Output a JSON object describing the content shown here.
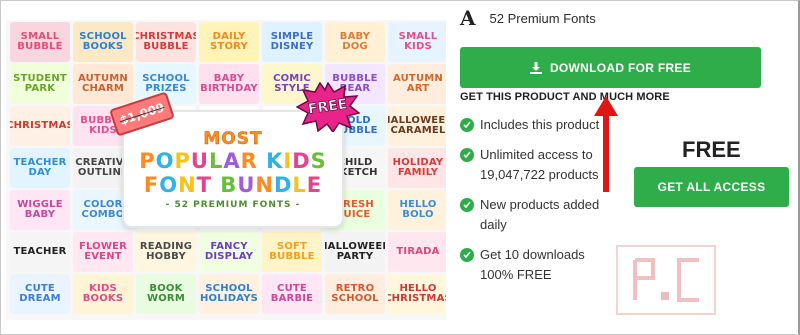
{
  "product": {
    "title_glyph": "A",
    "title": "52 Premium Fonts"
  },
  "collage": {
    "tiles": [
      [
        "SMALL BUBBLE",
        "#f8d6e0",
        "#e64b7a"
      ],
      [
        "SCHOOL BOOKS",
        "#fbe9c6",
        "#2f7fd4"
      ],
      [
        "CHRISTMAS BUBBLE",
        "#fde3e0",
        "#d43a3a"
      ],
      [
        "DAILY STORY",
        "#fff3b8",
        "#f08a1f"
      ],
      [
        "SIMPLE DISNEY",
        "#dff2ff",
        "#3c6ec8"
      ],
      [
        "BABY DOG",
        "#fff0d6",
        "#e07b32"
      ],
      [
        "SMALL KIDS",
        "#e6f4ff",
        "#e84c8b"
      ],
      [
        "STUDENT PARK",
        "#f0ffd9",
        "#6aa52a"
      ],
      [
        "AUTUMN CHARM",
        "#ffe8d6",
        "#c8622e"
      ],
      [
        "SCHOOL PRIZES",
        "#e6f7ff",
        "#3b86d6"
      ],
      [
        "BABY BIRTHDAY",
        "#ffe0ef",
        "#d84b93"
      ],
      [
        "COMIC STYLE",
        "#fff7cc",
        "#7a3fc4"
      ],
      [
        "BUBBLE BEAR",
        "#f3e6ff",
        "#8d4cc8"
      ],
      [
        "AUTUMN ART",
        "#ffeedd",
        "#d4662a"
      ],
      [
        "CHRISTMAS",
        "#fff0e6",
        "#c83a2a"
      ],
      [
        "BUBBLE KIDS",
        "#ffe3f1",
        "#e24d8f"
      ],
      [
        "",
        "#ffffff",
        "#ffffff"
      ],
      [
        "",
        "#ffffff",
        "#ffffff"
      ],
      [
        "",
        "#ffffff",
        "#ffffff"
      ],
      [
        "BOLD BUBBLE",
        "#e8f6ff",
        "#2f6fd0"
      ],
      [
        "HALLOWEEN CARAMEL",
        "#fff1dc",
        "#6b3a1e"
      ],
      [
        "TEACHER DAY",
        "#e2f5ff",
        "#2e8fd4"
      ],
      [
        "CREATIVE OUTLINE",
        "#f3f3f3",
        "#444444"
      ],
      [
        "",
        "#ffffff",
        "#ffffff"
      ],
      [
        "",
        "#ffffff",
        "#ffffff"
      ],
      [
        "",
        "#ffffff",
        "#ffffff"
      ],
      [
        "CHILD SKETCH",
        "#f6f6f6",
        "#333333"
      ],
      [
        "HOLIDAY FAMILY",
        "#ffe6e6",
        "#d83a3a"
      ],
      [
        "WIGGLE BABY",
        "#ffe6f4",
        "#c8469a"
      ],
      [
        "COLOR COMBO",
        "#eaf7ff",
        "#3a8ad0"
      ],
      [
        "",
        "#ffffff",
        "#ffffff"
      ],
      [
        "",
        "#ffffff",
        "#ffffff"
      ],
      [
        "",
        "#ffffff",
        "#ffffff"
      ],
      [
        "FRESH JUICE",
        "#eaffdf",
        "#e8572a"
      ],
      [
        "HELLO BOLO",
        "#fff2dc",
        "#3b8ed6"
      ],
      [
        "TEACHER",
        "#f5f5f5",
        "#222222"
      ],
      [
        "FLOWER EVENT",
        "#ffe8f1",
        "#d8478a"
      ],
      [
        "READING HOBBY",
        "#fff6e0",
        "#4a4a4a"
      ],
      [
        "FANCY DISPLAY",
        "#f0ffe0",
        "#6a3fc4"
      ],
      [
        "SOFT BUBBLE",
        "#fff3c8",
        "#f0a020"
      ],
      [
        "HALLOWEEN PARTY",
        "#f3f3f3",
        "#222222"
      ],
      [
        "TIRADA",
        "#ffe6ef",
        "#d8487a"
      ],
      [
        "CUTE DREAM",
        "#e9f4ff",
        "#3a7fd4"
      ],
      [
        "KIDS BOOKS",
        "#fff4d6",
        "#e04a8a"
      ],
      [
        "BOOK WORM",
        "#e9fbe0",
        "#3a8d3a"
      ],
      [
        "SCHOOL HOLIDAYS",
        "#fff0e0",
        "#2e7fd0"
      ],
      [
        "CUTE BARBIE",
        "#ffe6f4",
        "#d2449a"
      ],
      [
        "RETRO SCHOOL",
        "#ffeee0",
        "#d45a2a"
      ],
      [
        "HELLO CHRISTMAS",
        "#fff6dc",
        "#c83a3a"
      ]
    ],
    "price_tag": "$1,009",
    "free_badge": "FREE",
    "banner": {
      "most": "MOST",
      "line1": "POPULAR KIDS",
      "line2": "FONT BUNDLE",
      "sub": "- 52 PREMIUM FONTS -"
    },
    "banner_colors": [
      "#ff8a1f",
      "#2fb2e8",
      "#f7c21a",
      "#e8428a",
      "#6abf3a",
      "#a25ad8"
    ]
  },
  "actions": {
    "download_label": "DOWNLOAD FOR FREE",
    "get_product_label": "GET THIS PRODUCT AND MUCH MORE",
    "free_label": "FREE",
    "access_label": "GET ALL ACCESS"
  },
  "features": [
    {
      "text": "Includes this product"
    },
    {
      "text": "Unlimited access to 19,047,722 products"
    },
    {
      "text": "New products added daily"
    },
    {
      "text": "Get 10 downloads 100% FREE"
    }
  ],
  "colors": {
    "accent_green": "#2fad4a",
    "arrow_red": "#e01515"
  }
}
